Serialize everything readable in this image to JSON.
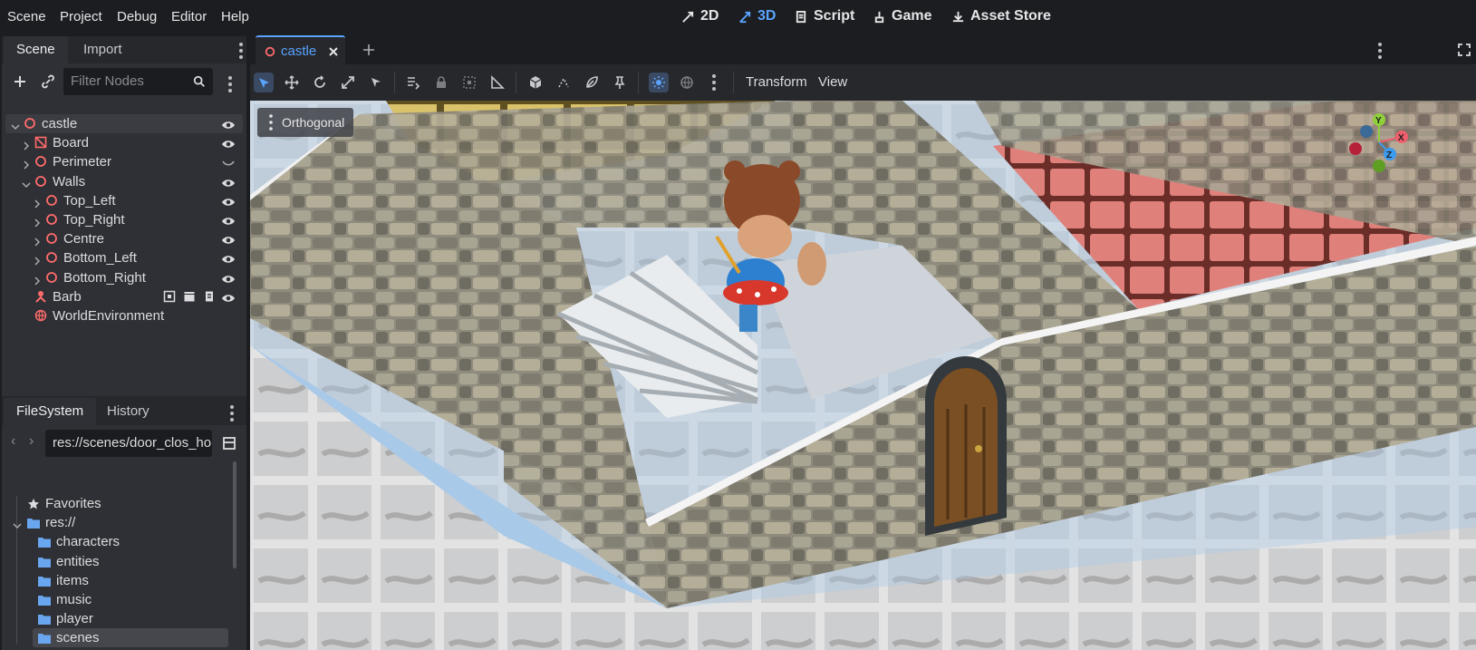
{
  "menu": [
    "Scene",
    "Project",
    "Debug",
    "Editor",
    "Help"
  ],
  "workspaces": [
    {
      "label": "2D",
      "active": false
    },
    {
      "label": "3D",
      "active": true
    },
    {
      "label": "Script",
      "active": false
    },
    {
      "label": "Game",
      "active": false
    },
    {
      "label": "Asset Store",
      "active": false
    }
  ],
  "scene_dock": {
    "tabs": [
      "Scene",
      "Import"
    ],
    "filter_placeholder": "Filter Nodes",
    "nodes": [
      {
        "label": "castle",
        "depth": 0,
        "expanded": true,
        "icon": "node3d-icon",
        "selected": true
      },
      {
        "label": "Board",
        "depth": 1,
        "expanded": false,
        "icon": "gridmap-icon"
      },
      {
        "label": "Perimeter",
        "depth": 1,
        "expanded": false,
        "icon": "node3d-icon",
        "hidden": true
      },
      {
        "label": "Walls",
        "depth": 1,
        "expanded": true,
        "icon": "node3d-icon"
      },
      {
        "label": "Top_Left",
        "depth": 2,
        "expanded": false,
        "icon": "node3d-icon"
      },
      {
        "label": "Top_Right",
        "depth": 2,
        "expanded": false,
        "icon": "node3d-icon"
      },
      {
        "label": "Centre",
        "depth": 2,
        "expanded": false,
        "icon": "node3d-icon"
      },
      {
        "label": "Bottom_Left",
        "depth": 2,
        "expanded": false,
        "icon": "node3d-icon"
      },
      {
        "label": "Bottom_Right",
        "depth": 2,
        "expanded": false,
        "icon": "node3d-icon"
      },
      {
        "label": "Barb",
        "depth": 1,
        "expanded": null,
        "icon": "character-icon"
      },
      {
        "label": "WorldEnvironment",
        "depth": 1,
        "expanded": null,
        "icon": "globe-icon"
      }
    ]
  },
  "filesystem_dock": {
    "tabs": [
      "FileSystem",
      "History"
    ],
    "path": "res://scenes/door_clos_ho",
    "items": [
      {
        "label": "Favorites",
        "icon": "star-icon",
        "depth": 0
      },
      {
        "label": "res://",
        "icon": "folder-icon",
        "depth": 0,
        "expanded": true
      },
      {
        "label": "characters",
        "icon": "folder-icon",
        "depth": 1
      },
      {
        "label": "entities",
        "icon": "folder-icon",
        "depth": 1
      },
      {
        "label": "items",
        "icon": "folder-icon",
        "depth": 1
      },
      {
        "label": "music",
        "icon": "folder-icon",
        "depth": 1
      },
      {
        "label": "player",
        "icon": "folder-icon",
        "depth": 1
      },
      {
        "label": "scenes",
        "icon": "folder-icon",
        "depth": 1,
        "selected": true
      }
    ]
  },
  "editor": {
    "scene_tab": "castle",
    "toolbar_transform": "Transform",
    "toolbar_view": "View",
    "viewport_label": "Orthogonal",
    "gizmo": {
      "y": "Y",
      "z": "Z",
      "x": "X"
    }
  },
  "colors": {
    "accent": "#5aa3ff",
    "node_red": "#ff6b6b",
    "folder_blue": "#6aa6f0"
  }
}
